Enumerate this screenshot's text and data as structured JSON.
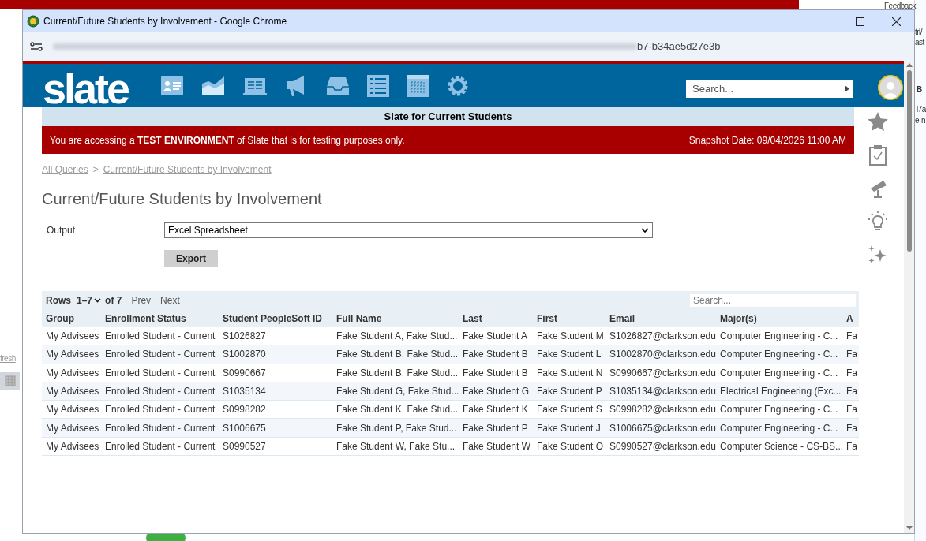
{
  "background": {
    "texts": [
      "Feedback",
      "trl/",
      "ast",
      "B",
      "l7a",
      "e-n",
      "fresh"
    ]
  },
  "window": {
    "title": "Current/Future Students by Involvement - Google Chrome",
    "url": "b7-b34ae5d27e3b"
  },
  "app": {
    "logo": "slate",
    "search_placeholder": "Search...",
    "banner": "Slate for Current Students",
    "alert": "You are accessing a **TEST ENVIRONMENT** of Slate that is for testing purposes only.",
    "snapshot": "Snapshot Date: 09/04/2026 11:00 AM"
  },
  "breadcrumb": [
    "All Queries",
    ">",
    "Current/Future Students by Involvement"
  ],
  "heading": "Current/Future Students by Involvement",
  "output": {
    "label": "Output",
    "value": "Excel Spreadsheet"
  },
  "export_button": "Export",
  "table": {
    "rows_label": "Rows",
    "range": "1–7",
    "of": "of 7",
    "prev": "Prev",
    "next": "Next",
    "search_placeholder": "Search...",
    "columns": [
      "Group",
      "Enrollment Status",
      "Student PeopleSoft ID",
      "Full Name",
      "Last",
      "First",
      "Email",
      "Major(s)",
      "A"
    ],
    "rows": [
      [
        "My Advisees",
        "Enrolled Student - Current",
        "S1026827",
        "Fake Student A, Fake Stud...",
        "Fake Student A",
        "Fake Student M",
        "S1026827@clarkson.edu",
        "Computer Engineering - C...",
        "Fa"
      ],
      [
        "My Advisees",
        "Enrolled Student - Current",
        "S1002870",
        "Fake Student B, Fake Stud...",
        "Fake Student B",
        "Fake Student L",
        "S1002870@clarkson.edu",
        "Computer Engineering - C...",
        "Fa"
      ],
      [
        "My Advisees",
        "Enrolled Student - Current",
        "S0990667",
        "Fake Student B, Fake Stud...",
        "Fake Student B",
        "Fake Student N",
        "S0990667@clarkson.edu",
        "Computer Engineering - C...",
        "Fa"
      ],
      [
        "My Advisees",
        "Enrolled Student - Current",
        "S1035134",
        "Fake Student G, Fake Stud...",
        "Fake Student G",
        "Fake Student P",
        "S1035134@clarkson.edu",
        "Electrical Engineering (Exc...",
        "Fa"
      ],
      [
        "My Advisees",
        "Enrolled Student - Current",
        "S0998282",
        "Fake Student K, Fake Stud...",
        "Fake Student K",
        "Fake Student S",
        "S0998282@clarkson.edu",
        "Computer Engineering - C...",
        "Fa"
      ],
      [
        "My Advisees",
        "Enrolled Student - Current",
        "S1006675",
        "Fake Student P, Fake Stud...",
        "Fake Student P",
        "Fake Student J",
        "S1006675@clarkson.edu",
        "Computer Engineering - C...",
        "Fa"
      ],
      [
        "My Advisees",
        "Enrolled Student - Current",
        "S0990527",
        "Fake Student W, Fake Stu...",
        "Fake Student W",
        "Fake Student O",
        "S0990527@clarkson.edu",
        "Computer Science - CS-BS...",
        "Fa"
      ]
    ]
  }
}
